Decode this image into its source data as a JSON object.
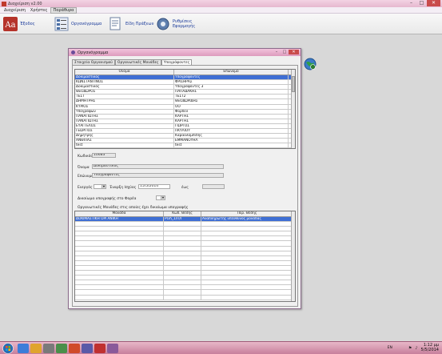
{
  "window": {
    "title": "Διαχείριση v2.00"
  },
  "menu": {
    "items": [
      "Διαχείριση",
      "Χρήστες",
      "Παράθυρα"
    ]
  },
  "ribbon": {
    "buttons": [
      {
        "label": "Έξοδος",
        "icon": "exit-icon"
      },
      {
        "label": "Οργανόγραμμα",
        "icon": "org-chart-icon"
      },
      {
        "label": "Είδη Πράξεων",
        "icon": "document-types-icon"
      },
      {
        "label": "Ρυθμίσεις Εφαρμογής",
        "icon": "settings-gear-icon"
      }
    ]
  },
  "dialog": {
    "title": "Οργανόγραμμα",
    "tabs": [
      "Στοιχεία Οργανισμού",
      "Οργανωτικές Μονάδες",
      "Υπογράφοντες"
    ],
    "active_tab": 2,
    "grid": {
      "headers": [
        "Όνομα",
        "Επώνυμο"
      ],
      "rows": [
        [
          "Δοκιμαστικός",
          "Υπογράφοντες"
        ],
        [
          "ΚΩΝΣΤΑΝΤΙΝΟΣ",
          "ΦΡΙΣΗΡΑΣ"
        ],
        [
          "Δοκιμαστικός",
          "Υπογράφοντες 3"
        ],
        [
          "ΘΕΟΔΩΡΟΣ",
          "ΠΑΠΑΔΑΚΗΣ"
        ],
        [
          "ΤΕΣΤ",
          "ΤΕΣΤ2"
        ],
        [
          "ΔΗΜΗΤΡΗΣ",
          "ΘΕΟΔΩΡΙΔΗΣ"
        ],
        [
          "ΚΥΡΙΟΣ",
          "ΟΟ"
        ],
        [
          "Υπογράφων",
          "Φορδελ"
        ],
        [
          "ΠΑΝΑΓΙΩΤΗΣ",
          "ΚΑΡΤΗΣ"
        ],
        [
          "ΠΑΝΑΓΙΩΤΗΣ",
          "ΚΑΡΤΗΣ"
        ],
        [
          "ΕΥΑΓΓΕΛΟΣ",
          "ΓΙΩΡΓΟΣ"
        ],
        [
          "ΓΕΩΡΓΙΟΣ",
          "ΠΚΥΛΙΟΥ"
        ],
        [
          "Δημήτρης",
          "Καραολαμπίδης"
        ],
        [
          "ΑΝΘΙΠΑΣ",
          "ΕΜΜΑΝΟΥΗΛ"
        ],
        [
          "test",
          "test"
        ]
      ]
    },
    "form": {
      "code_label": "Κωδικός",
      "code_value": "10683",
      "name_label": "Όνομα",
      "name_value": "Δοκιμαστικός",
      "surname_label": "Επώνυμο",
      "surname_value": "Υπογράφοντες",
      "active_label": "Ενεργός",
      "start_label": "Έναρξη Ισχύος",
      "start_value": "15/5/2014",
      "end_label": "έως",
      "end_value": "",
      "permission_label": "Δικαίωμα υπογραφής στο Φορέα",
      "units_label": "Οργανωτικές Μονάδες στις οποίες έχει δικαίωμα υπογραφής"
    },
    "grid2": {
      "headers": [
        "Μονάδα",
        "Κωδ. Θέσης",
        "Περ. Θέσης"
      ],
      "rows": [
        [
          "ΔΟΚΙΜΑΣΤΙΚΗ ΟΡΓΑΝΙΚΗ",
          "ΡΟΛ_1/Π/Γ",
          "Αναπληρωτής υπεύθυνος μονάδας"
        ]
      ]
    }
  },
  "taskbar": {
    "lang": "EN",
    "time": "1:12 μμ",
    "date": "5/5/2014"
  }
}
